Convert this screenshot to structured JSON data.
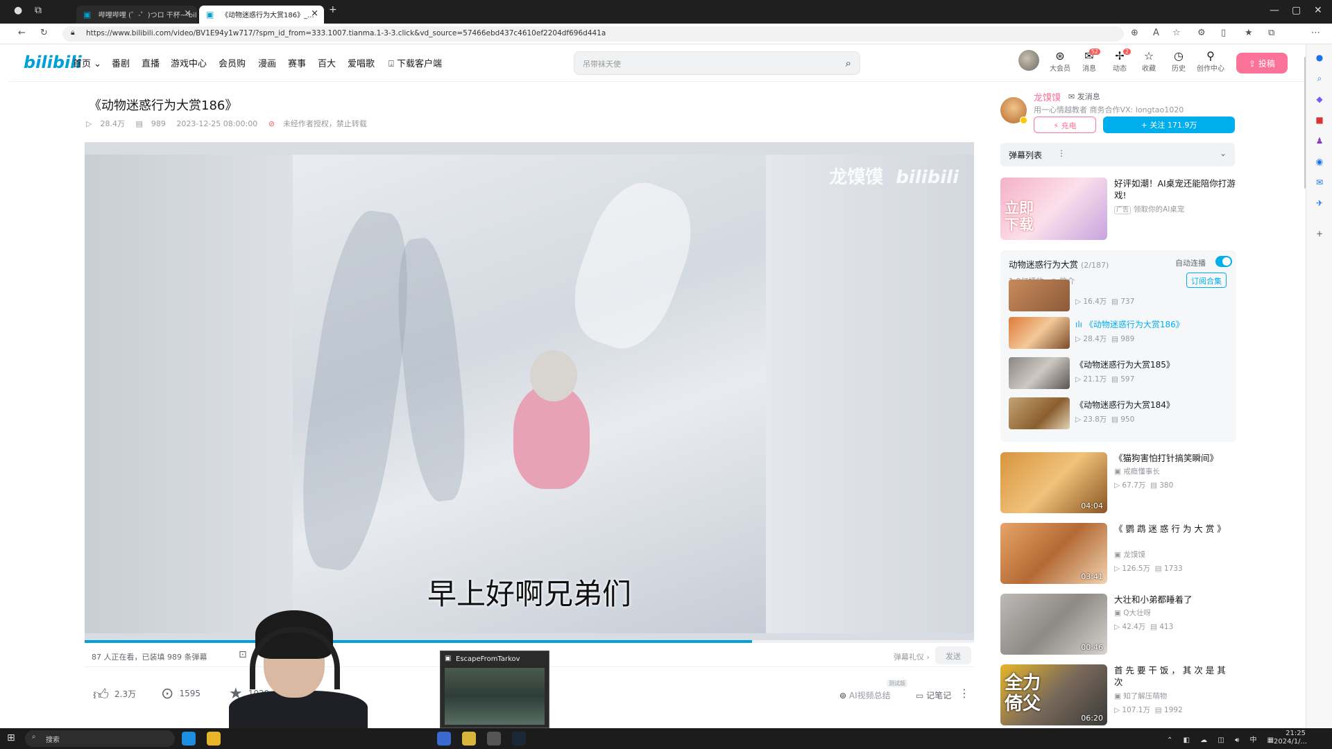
{
  "browser": {
    "tabs": [
      {
        "label": "哔哩哔哩 (゜-゜)つロ 干杯~-bili..."
      },
      {
        "label": "《动物迷惑行为大赏186》_..."
      }
    ],
    "url": "https://www.bilibili.com/video/BV1E94y1w717/?spm_id_from=333.1007.tianma.1-3-3.click&vd_source=57466ebd437c4610ef2204df696d441a"
  },
  "nav": {
    "logo": "bilibili",
    "items": [
      "首页",
      "番剧",
      "直播",
      "游戏中心",
      "会员购",
      "漫画",
      "赛事",
      "百大",
      "爱唱歌",
      "下载客户端"
    ],
    "search_placeholder": "吊带袜天使",
    "header_icons": [
      {
        "label": "大会员",
        "badge": ""
      },
      {
        "label": "消息",
        "badge": "52"
      },
      {
        "label": "动态",
        "badge": "2"
      },
      {
        "label": "收藏",
        "badge": ""
      },
      {
        "label": "历史",
        "badge": ""
      },
      {
        "label": "创作中心",
        "badge": ""
      }
    ],
    "upload": "投稿"
  },
  "video": {
    "title": "《动物迷惑行为大赏186》",
    "views": "28.4万",
    "danmaku": "989",
    "date": "2023-12-25 08:00:00",
    "copyright": "未经作者授权，禁止转载",
    "watermark_name": "龙馍馍",
    "watermark_logo": "bilibili",
    "subtitle": "早上好啊兄弟们",
    "progress_fraction": 0.75
  },
  "danmaku_bar": {
    "live_text": "87 人正在看，已装填 989 条弹幕",
    "etiquette": "弹幕礼仪 ›",
    "send": "发送"
  },
  "actions": {
    "like": "2.3万",
    "coin": "1595",
    "fav": "1029",
    "ai_summary": "AI视频总结",
    "test_badge": "测试版",
    "notes": "记笔记"
  },
  "overlay": {
    "popup_title": "EscapeFromTarkov"
  },
  "uploader": {
    "name": "龙馍馍",
    "message": "发消息",
    "desc": "用一心情越教者 商务合作VX: longtao1020",
    "charge": "充电",
    "follow": "+ 关注 171.9万"
  },
  "danmaku_list": {
    "label": "弹幕列表"
  },
  "ad": {
    "img_text": "立即下载",
    "title": "好评如潮！AI桌宠还能陪你打游戏!",
    "tag": "广告",
    "sub": "领取你的AI桌宠"
  },
  "collection": {
    "title": "动物迷惑行为大赏",
    "count": "(2/187)",
    "autoplay": "自动连播",
    "plays": "1.8亿播放",
    "intro": "简介",
    "subscribe": "订阅合集",
    "episodes": [
      {
        "title": "",
        "views": "16.4万",
        "dm": "737"
      },
      {
        "title": "《动物迷惑行为大赏186》",
        "views": "28.4万",
        "dm": "989"
      },
      {
        "title": "《动物迷惑行为大赏185》",
        "views": "21.1万",
        "dm": "597"
      },
      {
        "title": "《动物迷惑行为大赏184》",
        "views": "23.8万",
        "dm": "950"
      }
    ]
  },
  "recommendations": [
    {
      "title": "《猫狗害怕打针搞笑瞬间》",
      "up": "戒瘾懂事长",
      "views": "67.7万",
      "dm": "380",
      "dur": "04:04"
    },
    {
      "title": "《 鹦 鹉 迷 惑 行 为 大 赏 》",
      "up": "龙馍馍",
      "views": "126.5万",
      "dm": "1733",
      "dur": "03:41"
    },
    {
      "title": "大壮和小弟都睡着了",
      "up": "Q大壮呀",
      "views": "42.4万",
      "dm": "413",
      "dur": "00:46"
    },
    {
      "title": "首 先 要 干 饭 ， 其 次 是 其 次",
      "up": "知了解压萌物",
      "views": "107.1万",
      "dm": "1992",
      "dur": "06:20",
      "thumb_text": "全力倚父"
    }
  ],
  "taskbar": {
    "search": "搜索",
    "time": "21:25",
    "date": "2024/1/..."
  }
}
